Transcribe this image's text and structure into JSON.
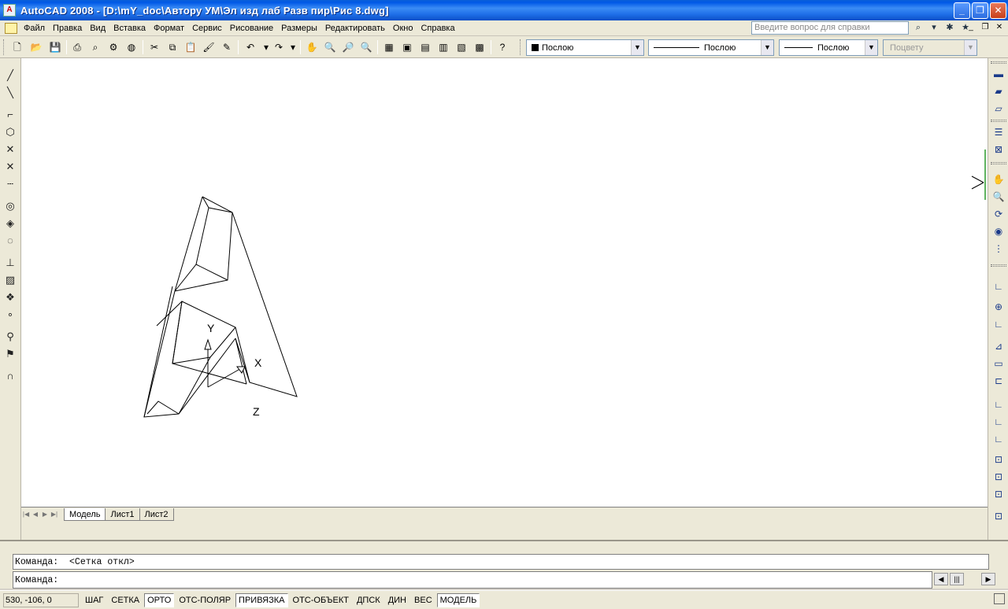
{
  "window": {
    "title": "AutoCAD 2008 - [D:\\mY_doc\\Автору УМ\\Эл изд лаб Разв пир\\Рис 8.dwg]",
    "app_icon_text": "A"
  },
  "menu": {
    "items": [
      "Файл",
      "Правка",
      "Вид",
      "Вставка",
      "Формат",
      "Сервис",
      "Рисование",
      "Размеры",
      "Редактировать",
      "Окно",
      "Справка"
    ],
    "help_placeholder": "Введите вопрос для справки"
  },
  "properties_toolbar": {
    "color": "Послою",
    "linetype": "Послою",
    "lineweight": "Послою",
    "plotstyle": "Поцвету"
  },
  "ucs_icon": {
    "y_label": "Y",
    "x_label": "X",
    "z_label": "Z"
  },
  "tabs": {
    "items": [
      "Модель",
      "Лист1",
      "Лист2"
    ],
    "active": "Модель"
  },
  "command": {
    "history": "Команда:  <Сетка откл>",
    "prompt": "Команда:"
  },
  "status": {
    "coords": "530, -106, 0",
    "buttons": [
      {
        "label": "ШАГ",
        "on": false
      },
      {
        "label": "СЕТКА",
        "on": false
      },
      {
        "label": "ОРТО",
        "on": true
      },
      {
        "label": "ОТС-ПОЛЯР",
        "on": false
      },
      {
        "label": "ПРИВЯЗКА",
        "on": true
      },
      {
        "label": "ОТС-ОБЪЕКТ",
        "on": false
      },
      {
        "label": "ДПСК",
        "on": false
      },
      {
        "label": "ДИН",
        "on": false
      },
      {
        "label": "ВЕС",
        "on": false
      },
      {
        "label": "МОДЕЛЬ",
        "on": true
      }
    ]
  }
}
